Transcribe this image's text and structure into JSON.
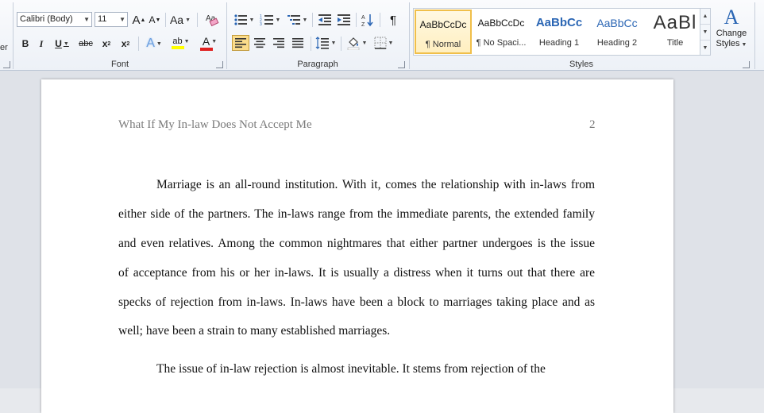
{
  "ribbon": {
    "clipboard_partial_label": "er",
    "font": {
      "group_label": "Font",
      "font_name": "Calibri (Body)",
      "font_size": "11",
      "grow_glyph": "A",
      "shrink_glyph": "A",
      "change_case_glyph": "Aa",
      "bold": "B",
      "italic": "I",
      "underline": "U",
      "strike": "abc",
      "subscript": "x",
      "superscript": "x",
      "text_effect_glyph": "A",
      "highlight_glyph": "ab",
      "font_color_glyph": "A",
      "highlight_color": "#ffff00",
      "font_color": "#e02020"
    },
    "paragraph": {
      "group_label": "Paragraph",
      "pilcrow": "¶"
    },
    "styles": {
      "group_label": "Styles",
      "tiles": [
        {
          "sample": "AaBbCcDc",
          "name": "¶ Normal"
        },
        {
          "sample": "AaBbCcDc",
          "name": "¶ No Spaci..."
        },
        {
          "sample": "AaBbCc",
          "name": "Heading 1"
        },
        {
          "sample": "AaBbCc",
          "name": "Heading 2"
        },
        {
          "sample": "AaBl",
          "name": "Title"
        }
      ],
      "change_styles_line1": "Change",
      "change_styles_line2": "Styles",
      "change_styles_glyph": "A",
      "heading_color": "#2b66b4"
    }
  },
  "document": {
    "header_title": "What If My In-law Does Not Accept Me",
    "page_number": "2",
    "lines": [
      "Marriage is an all-round institution. With it, comes the relationship with in-laws from",
      "either side of the partners. The in-laws range from the immediate parents, the extended family",
      "and even relatives. Among the common nightmares that either partner undergoes is the issue",
      "of acceptance from his or her in-laws. It is usually a distress when it turns out that there are",
      "specks of rejection from in-laws. In-laws have been a block to marriages taking place and as",
      "well; have been a strain to many established marriages.",
      "The issue of in-law rejection is almost inevitable. It stems from rejection of the"
    ]
  }
}
